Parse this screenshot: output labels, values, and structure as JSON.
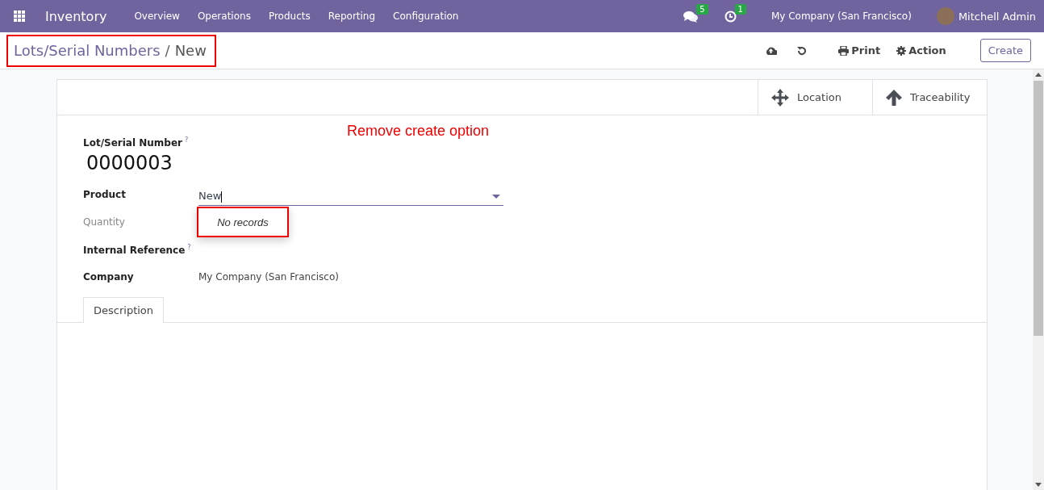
{
  "navbar": {
    "app": "Inventory",
    "menus": [
      "Overview",
      "Operations",
      "Products",
      "Reporting",
      "Configuration"
    ],
    "messages_badge": "5",
    "activities_badge": "1",
    "company": "My Company (San Francisco)",
    "user": "Mitchell Admin"
  },
  "control_panel": {
    "breadcrumb_separator": "/",
    "breadcrumb": [
      {
        "label": "Lots/Serial Numbers",
        "kind": "link"
      },
      {
        "label": "New",
        "kind": "current"
      }
    ],
    "actions": [
      {
        "label": "Print",
        "kind": "print"
      },
      {
        "label": "Action",
        "kind": "gear"
      }
    ],
    "create_button": "Create"
  },
  "smart_buttons": [
    {
      "label": "Location",
      "kind": "move"
    },
    {
      "label": "Traceability",
      "kind": "up"
    }
  ],
  "annotation": "Remove create option",
  "form": {
    "title_label": "Lot/Serial Number",
    "title_help": "?",
    "title_value": "0000003",
    "fields": [
      {
        "label": "Product",
        "kind": "many2one",
        "muted": false,
        "value": "New",
        "dropdown": "No records"
      },
      {
        "label": "Quantity",
        "kind": "empty",
        "muted": true
      },
      {
        "label": "Internal Reference",
        "kind": "empty",
        "muted": false,
        "help": "?"
      },
      {
        "label": "Company",
        "kind": "text",
        "muted": false,
        "value": "My Company (San Francisco)"
      }
    ],
    "tabs": [
      {
        "label": "Description",
        "selected": true
      }
    ]
  }
}
